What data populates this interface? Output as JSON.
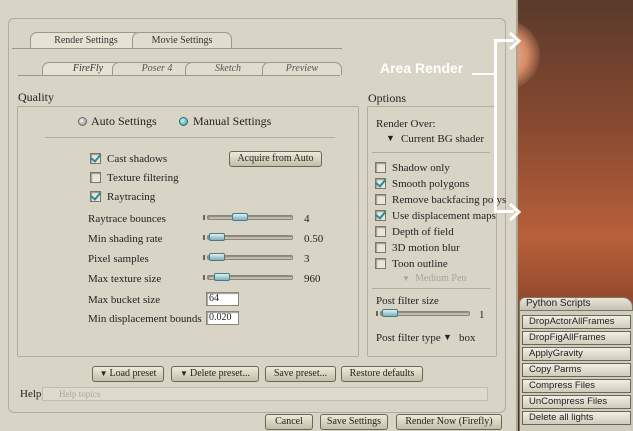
{
  "tabs": {
    "main": [
      "Render Settings",
      "Movie Settings"
    ],
    "sub": [
      "FireFly",
      "Poser 4",
      "Sketch",
      "Preview"
    ]
  },
  "quality": {
    "title": "Quality",
    "auto_label": "Auto Settings",
    "manual_label": "Manual Settings",
    "cast_shadows": "Cast shadows",
    "texture_filtering": "Texture filtering",
    "raytracing": "Raytracing",
    "acquire_button": "Acquire from Auto",
    "raytrace_bounces": {
      "label": "Raytrace bounces",
      "value": "4"
    },
    "min_shading_rate": {
      "label": "Min shading rate",
      "value": "0.50"
    },
    "pixel_samples": {
      "label": "Pixel samples",
      "value": "3"
    },
    "max_texture_size": {
      "label": "Max texture size",
      "value": "960"
    },
    "max_bucket_size": {
      "label": "Max bucket size",
      "value": "64"
    },
    "min_displacement_bounds": {
      "label": "Min displacement bounds",
      "value": "0.020"
    }
  },
  "options": {
    "title": "Options",
    "render_over_label": "Render Over:",
    "render_over_value": "Current BG shader",
    "shadow_only": "Shadow only",
    "smooth_polygons": "Smooth polygons",
    "remove_backfacing": "Remove backfacing polys",
    "use_displacement": "Use displacement maps",
    "depth_of_field": "Depth of field",
    "motion_blur": "3D motion blur",
    "toon_outline": "Toon outline",
    "pen": "Medium Pen",
    "post_filter_size_label": "Post filter size",
    "post_filter_size_value": "1",
    "post_filter_type_label": "Post filter type",
    "post_filter_type_value": "box"
  },
  "presets": {
    "load": "Load preset",
    "delete": "Delete preset...",
    "save": "Save preset...",
    "restore": "Restore defaults"
  },
  "help": {
    "label": "Help:",
    "placeholder": "Help topics"
  },
  "footer": {
    "cancel": "Cancel",
    "save": "Save Settings",
    "render_now": "Render Now (Firefly)"
  },
  "annotation": "Area Render",
  "python": {
    "title": "Python Scripts",
    "items": [
      "DropActorAllFrames",
      "DropFigAllFrames",
      "ApplyGravity",
      "Copy Parms",
      "Compress Files",
      "UnCompress Files",
      "Delete all lights"
    ]
  }
}
